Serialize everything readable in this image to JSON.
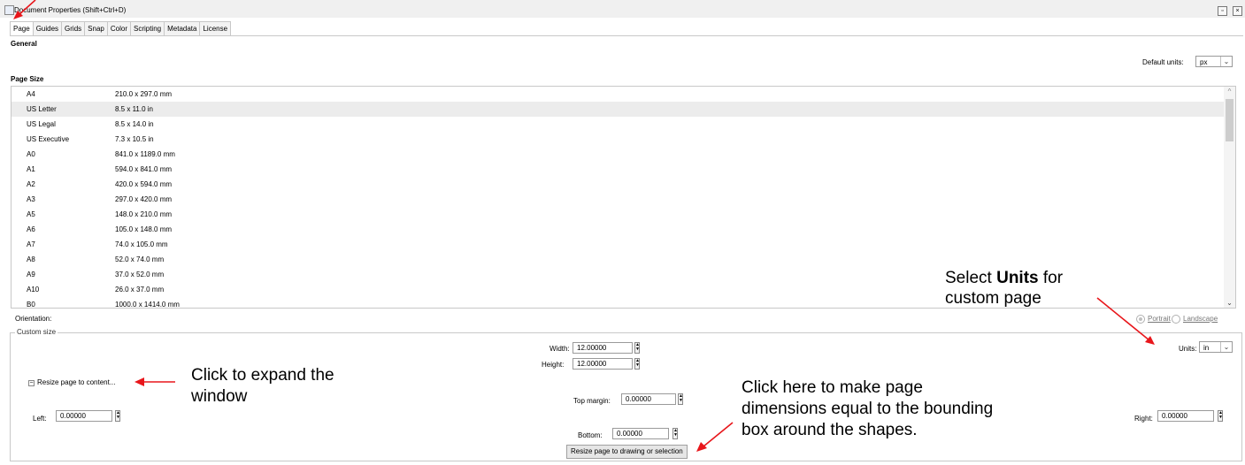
{
  "window": {
    "title": "Document Properties (Shift+Ctrl+D)"
  },
  "tabs": [
    "Page",
    "Guides",
    "Grids",
    "Snap",
    "Color",
    "Scripting",
    "Metadata",
    "License"
  ],
  "general": {
    "heading": "General",
    "default_units_label": "Default units:",
    "default_units_value": "px"
  },
  "page_size": {
    "heading": "Page Size",
    "rows": [
      {
        "name": "A4",
        "size": "210.0 x 297.0 mm"
      },
      {
        "name": "US Letter",
        "size": "8.5 x 11.0 in"
      },
      {
        "name": "US Legal",
        "size": "8.5 x 14.0 in"
      },
      {
        "name": "US Executive",
        "size": "7.3 x 10.5 in"
      },
      {
        "name": "A0",
        "size": "841.0 x 1189.0 mm"
      },
      {
        "name": "A1",
        "size": "594.0 x 841.0 mm"
      },
      {
        "name": "A2",
        "size": "420.0 x 594.0 mm"
      },
      {
        "name": "A3",
        "size": "297.0 x 420.0 mm"
      },
      {
        "name": "A5",
        "size": "148.0 x 210.0 mm"
      },
      {
        "name": "A6",
        "size": "105.0 x 148.0 mm"
      },
      {
        "name": "A7",
        "size": "74.0 x 105.0 mm"
      },
      {
        "name": "A8",
        "size": "52.0 x 74.0 mm"
      },
      {
        "name": "A9",
        "size": "37.0 x 52.0 mm"
      },
      {
        "name": "A10",
        "size": "26.0 x 37.0 mm"
      },
      {
        "name": "B0",
        "size": "1000.0 x 1414.0 mm"
      }
    ],
    "selected": "US Letter"
  },
  "orientation": {
    "label": "Orientation:",
    "portrait": "Portrait",
    "landscape": "Landscape",
    "selected": "Portrait"
  },
  "custom_size": {
    "legend": "Custom size",
    "width_label": "Width:",
    "width_value": "12.00000",
    "height_label": "Height:",
    "height_value": "12.00000",
    "units_label": "Units:",
    "units_value": "in",
    "resize_expander": "Resize page to content...",
    "top_margin_label": "Top margin:",
    "top_margin_value": "0.00000",
    "left_label": "Left:",
    "left_value": "0.00000",
    "right_label": "Right:",
    "right_value": "0.00000",
    "bottom_label": "Bottom:",
    "bottom_value": "0.00000",
    "resize_button": "Resize page to drawing or selection"
  },
  "annotations": {
    "units_note_line1_prefix": "Select ",
    "units_note_line1_bold": "Units",
    "units_note_line1_suffix": " for",
    "units_note_line2": "custom page",
    "expand_note_line1": "Click to expand the",
    "expand_note_line2": "window",
    "resize_note_line1": "Click here to make page",
    "resize_note_line2": "dimensions equal to the bounding",
    "resize_note_line3": "box around the shapes.",
    "arrow_color": "#e8161b"
  }
}
